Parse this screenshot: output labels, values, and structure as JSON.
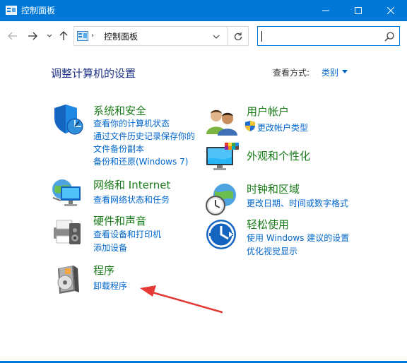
{
  "window": {
    "title": "控制面板"
  },
  "address": {
    "crumb": "控制面板",
    "search_placeholder": ""
  },
  "header": {
    "title": "调整计算机的设置",
    "view_by_label": "查看方式:",
    "view_by_value": "类别"
  },
  "categories": {
    "system": {
      "title": "系统和安全",
      "links": [
        "查看你的计算机状态",
        "通过文件历史记录保存你的",
        "文件备份副本",
        "备份和还原(Windows 7)"
      ]
    },
    "network": {
      "title": "网络和 Internet",
      "links": [
        "查看网络状态和任务"
      ]
    },
    "hardware": {
      "title": "硬件和声音",
      "links": [
        "查看设备和打印机",
        "添加设备"
      ]
    },
    "programs": {
      "title": "程序",
      "links": [
        "卸载程序"
      ]
    },
    "user": {
      "title": "用户帐户",
      "links": [
        "更改帐户类型"
      ]
    },
    "appearance": {
      "title": "外观和个性化",
      "links": []
    },
    "clock": {
      "title": "时钟和区域",
      "links": [
        "更改日期、时间或数字格式"
      ]
    },
    "ease": {
      "title": "轻松使用",
      "links": [
        "使用 Windows 建议的设置",
        "优化视觉显示"
      ]
    }
  },
  "colors": {
    "accent": "#0078d7",
    "category_title": "#1a7b1a",
    "link": "#0066cc",
    "annotation_arrow": "#e53935"
  }
}
